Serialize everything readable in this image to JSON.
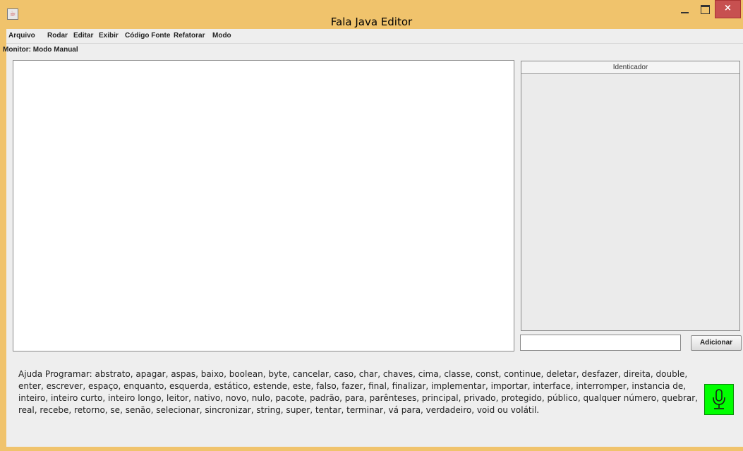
{
  "window": {
    "title": "Fala Java Editor",
    "close_glyph": "×"
  },
  "menu": {
    "items": [
      "Arquivo",
      "Rodar",
      "Editar",
      "Exibir",
      "Código Fonte",
      "Refatorar",
      "Modo"
    ]
  },
  "status": {
    "monitor": "Monitor: Modo Manual"
  },
  "table": {
    "header": "Identicador",
    "rows": []
  },
  "identifier_input": {
    "value": ""
  },
  "add_button": {
    "label": "Adicionar"
  },
  "help": {
    "text": "Ajuda Programar: abstrato, apagar, aspas, baixo, boolean, byte, cancelar, caso, char, chaves, cima, classe, const, continue, deletar, desfazer, direita, double, enter, escrever, espaço, enquanto, esquerda, estático, estende, este, falso, fazer, final, finalizar, implementar, importar, interface, interromper, instancia de, inteiro, inteiro curto, inteiro longo, leitor, nativo, novo, nulo, pacote, padrão, para, parênteses, principal, privado, protegido, público, qualquer número, quebrar, real, recebe, retorno, se, senão, selecionar, sincronizar, string, super, tentar, terminar, vá para, verdadeiro, void ou volátil."
  },
  "colors": {
    "frame": "#f0c36c",
    "mic_button": "#00ff00",
    "close_button": "#c75050"
  },
  "icons": {
    "app": "java-cup-icon",
    "mic": "microphone-icon"
  }
}
